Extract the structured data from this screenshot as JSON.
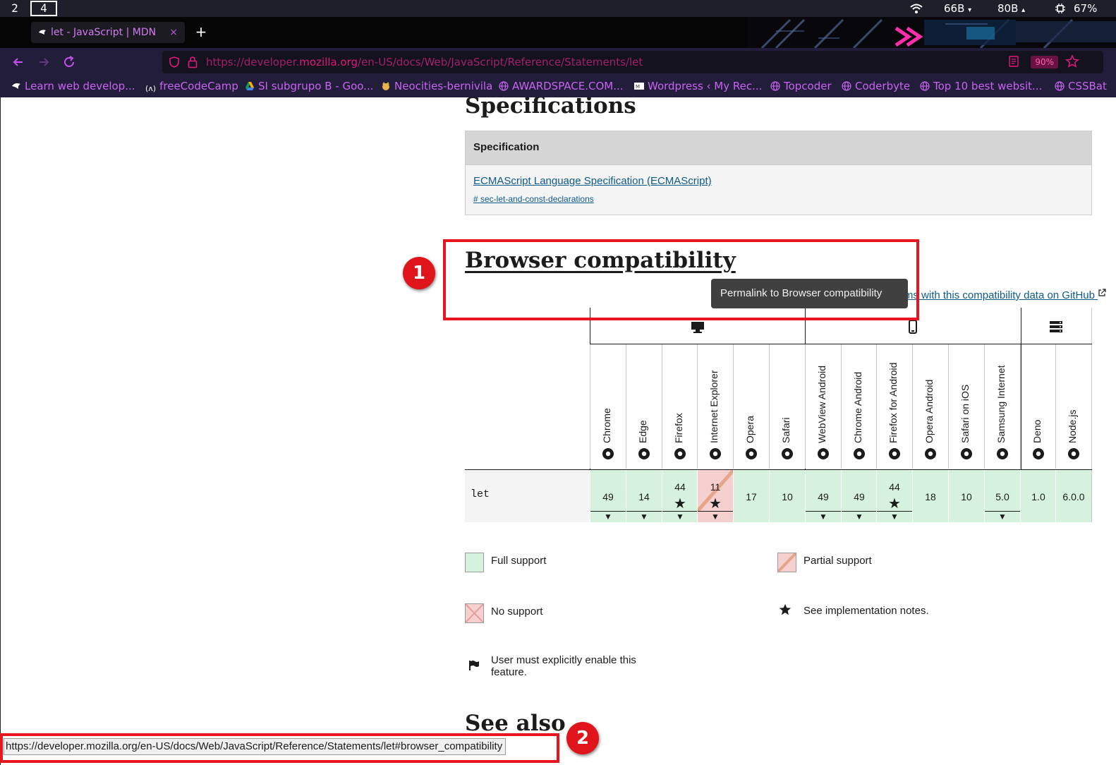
{
  "system_bar": {
    "workspaces": [
      "2",
      "4"
    ],
    "net_down": "66B",
    "net_up": "80B",
    "battery": "67%"
  },
  "browser": {
    "tab_title": "let - JavaScript | MDN",
    "tab_close": "×",
    "new_tab": "+",
    "url_prefix": "https://developer.",
    "url_domain": "mozilla.org",
    "url_path": "/en-US/docs/Web/JavaScript/Reference/Statements/let",
    "zoom": "90%",
    "bookmarks": [
      "Learn web develop...",
      "freeCodeCamp",
      "SI subgrupo B - Goo...",
      "Neocities-bernivila",
      "AWARDSPACE.COM...",
      "Wordpress ‹ My Rec...",
      "Topcoder",
      "Coderbyte",
      "Top 10 best websit...",
      "CSSBat"
    ]
  },
  "specifications": {
    "heading": "Specifications",
    "table_header": "Specification",
    "spec_link": "ECMAScript Language Specification (ECMAScript)",
    "spec_anchor": "# sec-let-and-const-declarations"
  },
  "compat": {
    "heading": "Browser compatibility",
    "report_link": "Report problems with this compatibility data on GitHub",
    "tooltip": "Permalink to Browser compatibility",
    "feature": "let",
    "browsers": [
      {
        "name": "Chrome",
        "version": "49",
        "note": false,
        "flag": true,
        "support": "full"
      },
      {
        "name": "Edge",
        "version": "14",
        "note": false,
        "flag": true,
        "support": "full"
      },
      {
        "name": "Firefox",
        "version": "44",
        "note": true,
        "flag": true,
        "support": "full"
      },
      {
        "name": "Internet Explorer",
        "version": "11",
        "note": true,
        "flag": true,
        "support": "partial"
      },
      {
        "name": "Opera",
        "version": "17",
        "note": false,
        "flag": false,
        "support": "full"
      },
      {
        "name": "Safari",
        "version": "10",
        "note": false,
        "flag": false,
        "support": "full"
      },
      {
        "name": "WebView Android",
        "version": "49",
        "note": false,
        "flag": true,
        "support": "full"
      },
      {
        "name": "Chrome Android",
        "version": "49",
        "note": false,
        "flag": true,
        "support": "full"
      },
      {
        "name": "Firefox for Android",
        "version": "44",
        "note": true,
        "flag": true,
        "support": "full"
      },
      {
        "name": "Opera Android",
        "version": "18",
        "note": false,
        "flag": false,
        "support": "full"
      },
      {
        "name": "Safari on iOS",
        "version": "10",
        "note": false,
        "flag": false,
        "support": "full"
      },
      {
        "name": "Samsung Internet",
        "version": "5.0",
        "note": false,
        "flag": true,
        "support": "full"
      },
      {
        "name": "Deno",
        "version": "1.0",
        "note": false,
        "flag": false,
        "support": "full"
      },
      {
        "name": "Node.js",
        "version": "6.0.0",
        "note": false,
        "flag": false,
        "support": "full"
      }
    ],
    "legend": {
      "full": "Full support",
      "partial": "Partial support",
      "none": "No support",
      "notes": "See implementation notes.",
      "flag": "User must explicitly enable this feature."
    }
  },
  "see_also": {
    "heading": "See also"
  },
  "status_bar": "https://developer.mozilla.org/en-US/docs/Web/JavaScript/Reference/Statements/let#browser_compatibility",
  "annotations": [
    "1",
    "2"
  ],
  "colors": {
    "full_support": "#d6f2df",
    "partial_support": "#f6cfcf",
    "annotation_red": "#e8141e",
    "link": "#0e5a8a",
    "url_accent": "#e0197a"
  }
}
